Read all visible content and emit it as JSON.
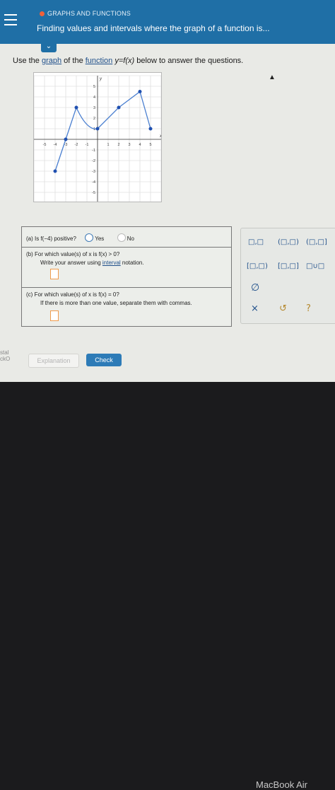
{
  "header": {
    "section_label": "GRAPHS AND FUNCTIONS",
    "title": "Finding values and intervals where the graph of a function is..."
  },
  "prompt": {
    "before": "Use the ",
    "link1": "graph",
    "mid1": " of the ",
    "link2": "function",
    "math": " y=f(x) ",
    "after": "below to answer the questions."
  },
  "graph": {
    "x_ticks": [
      "-5",
      "-4",
      "-3",
      "-2",
      "-1",
      "1",
      "2",
      "3",
      "4",
      "5"
    ],
    "y_ticks": [
      "5",
      "4",
      "3",
      "2",
      "1",
      "-1",
      "-2",
      "-3",
      "-4",
      "-5"
    ],
    "x_label": "x",
    "y_label": "y",
    "points": [
      {
        "x": -4,
        "y": -3,
        "filled": true
      },
      {
        "x": -3,
        "y": 0,
        "filled": true
      },
      {
        "x": -2,
        "y": 3,
        "filled": true
      },
      {
        "x": 0,
        "y": 1,
        "filled": true
      },
      {
        "x": 2,
        "y": 3,
        "filled": true
      },
      {
        "x": 4,
        "y": 4.5,
        "filled": true
      },
      {
        "x": 5,
        "y": 1,
        "filled": true
      }
    ]
  },
  "questions": {
    "a": {
      "label": "(a)",
      "text": "Is f(−4) positive?",
      "yes": "Yes",
      "no": "No"
    },
    "b": {
      "label": "(b)",
      "text": "For which value(s) of x is f(x) > 0?",
      "note_before": "Write your answer using ",
      "note_link": "interval",
      "note_after": " notation."
    },
    "c": {
      "label": "(c)",
      "text": "For which value(s) of x is f(x) = 0?",
      "note": "If there is more than one value, separate them with commas."
    }
  },
  "keypad": {
    "row1": [
      "□,□",
      "(□,□)",
      "(□,□]"
    ],
    "row2": [
      "[□,□)",
      "[□,□]",
      "□∪□"
    ],
    "empty_set": "∅",
    "clear": "×",
    "undo": "↺",
    "help": "?"
  },
  "actions": {
    "explanation": "Explanation",
    "check": "Check"
  },
  "side_fragment": [
    "stal",
    "ckO"
  ],
  "device_brand": "MacBook Air"
}
